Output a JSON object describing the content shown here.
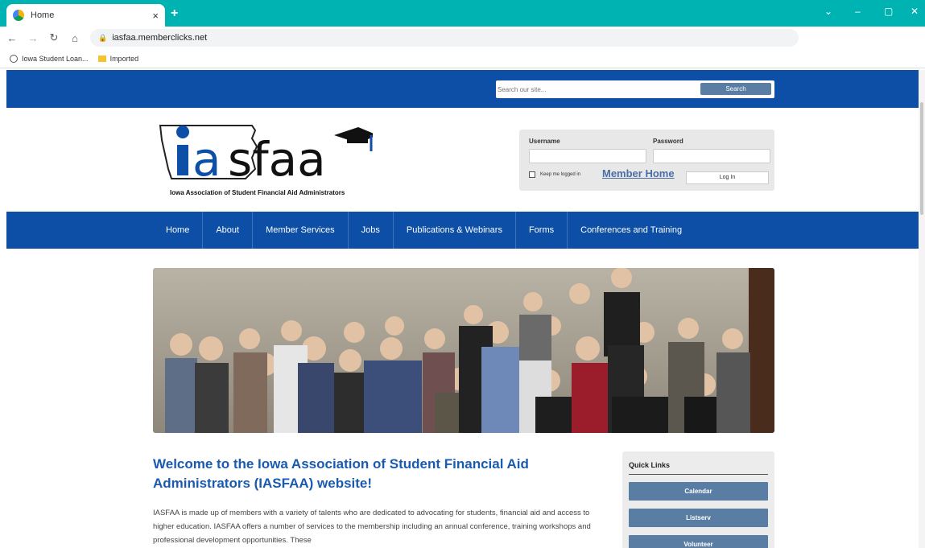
{
  "browser": {
    "tab_title": "Home",
    "url": "iasfaa.memberclicks.net",
    "bookmarks": [
      "Iowa Student Loan...",
      "Imported"
    ]
  },
  "site": {
    "search_placeholder": "Search our site...",
    "search_label": "Search",
    "logo_text": "iasfaa",
    "logo_tagline": "Iowa Association of Student Financial Aid Administrators",
    "login": {
      "username_label": "Username",
      "password_label": "Password",
      "keep_logged_in": "Keep me logged in",
      "member_home": "Member Home",
      "login_button": "Log In"
    },
    "nav": [
      "Home",
      "About",
      "Member Services",
      "Jobs",
      "Publications & Webinars",
      "Forms",
      "Conferences and Training"
    ],
    "welcome_heading": "Welcome to the Iowa Association of Student Financial Aid Administrators (IASFAA) website!",
    "intro_text": "IASFAA is made up of members with a variety of talents who are dedicated to advocating for students, financial aid and access to higher education.  IASFAA offers a number of services to the membership including an annual conference, training workshops and professional development opportunities.  These",
    "quick_links": {
      "title": "Quick Links",
      "items": [
        "Calendar",
        "Listserv",
        "Volunteer"
      ]
    }
  },
  "colors": {
    "brand_blue": "#0d4ea6",
    "heading_blue": "#1a5bb0",
    "button_slate": "#5a7ea3",
    "tab_teal": "#00b3b3"
  }
}
